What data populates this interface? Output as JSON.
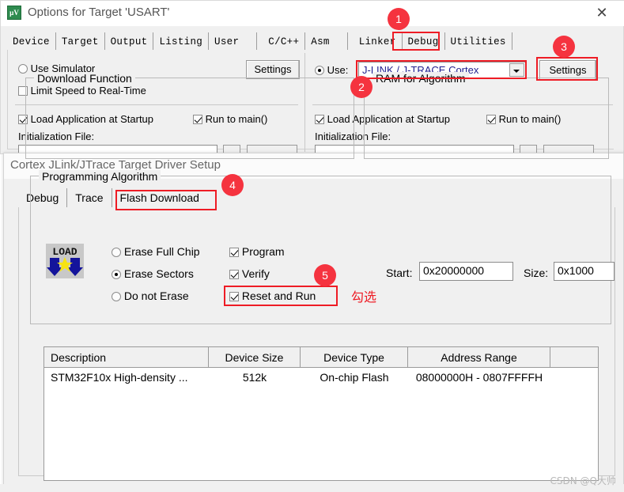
{
  "options_dialog": {
    "title": "Options for Target 'USART'",
    "app_icon": "uvision-icon",
    "close_icon": "close-icon",
    "tabs": [
      {
        "label": "Device",
        "selected": false
      },
      {
        "label": "Target",
        "selected": false
      },
      {
        "label": "Output",
        "selected": false
      },
      {
        "label": "Listing",
        "selected": false
      },
      {
        "label": "User",
        "selected": false
      },
      {
        "label": "C/C++",
        "selected": false
      },
      {
        "label": "Asm",
        "selected": false
      },
      {
        "label": "Linker",
        "selected": false
      },
      {
        "label": "Debug",
        "selected": true
      },
      {
        "label": "Utilities",
        "selected": false
      }
    ],
    "left_panel": {
      "use_simulator_label": "Use Simulator",
      "use_simulator_checked": false,
      "limit_speed_label": "Limit Speed to Real-Time",
      "limit_speed_checked": false,
      "settings_label": "Settings",
      "load_application_label": "Load Application at Startup",
      "load_application_checked": true,
      "run_to_main_label": "Run to main()",
      "run_to_main_checked": true,
      "init_file_label": "Initialization File:",
      "init_file_value": ""
    },
    "right_panel": {
      "use_label": "Use:",
      "use_checked": true,
      "driver_value": "J-LINK / J-TRACE Cortex",
      "settings_label": "Settings",
      "load_application_label": "Load Application at Startup",
      "load_application_checked": true,
      "run_to_main_label": "Run to main()",
      "run_to_main_checked": true,
      "init_file_label": "Initialization File:",
      "init_file_value": ""
    }
  },
  "jlink_dialog": {
    "title": "Cortex JLink/JTrace Target Driver Setup",
    "tabs": [
      {
        "label": "Debug",
        "selected": false
      },
      {
        "label": "Trace",
        "selected": false
      },
      {
        "label": "Flash Download",
        "selected": true
      }
    ],
    "download_function": {
      "group_title": "Download Function",
      "load_icon": "load-icon",
      "load_icon_text": "LOAD",
      "erase_full_chip_label": "Erase Full Chip",
      "erase_full_chip_checked": false,
      "erase_sectors_label": "Erase Sectors",
      "erase_sectors_checked": true,
      "do_not_erase_label": "Do not Erase",
      "do_not_erase_checked": false,
      "program_label": "Program",
      "program_checked": true,
      "verify_label": "Verify",
      "verify_checked": true,
      "reset_and_run_label": "Reset and Run",
      "reset_and_run_checked": true
    },
    "ram_for_algorithm": {
      "group_title": "RAM for Algorithm",
      "start_label": "Start:",
      "start_value": "0x20000000",
      "size_label": "Size:",
      "size_value": "0x1000"
    },
    "programming_algorithm": {
      "group_title": "Programming Algorithm",
      "columns": [
        "Description",
        "Device Size",
        "Device Type",
        "Address Range",
        ""
      ],
      "rows": [
        {
          "description": "STM32F10x High-density ...",
          "device_size": "512k",
          "device_type": "On-chip Flash",
          "address_range": "08000000H - 0807FFFFH",
          "extra": ""
        }
      ]
    }
  },
  "annotations": {
    "badges": [
      {
        "id": "1",
        "target": "debug-tab"
      },
      {
        "id": "2",
        "target": "driver-select"
      },
      {
        "id": "3",
        "target": "jlink-settings-button"
      },
      {
        "id": "4",
        "target": "flash-download-tab"
      },
      {
        "id": "5",
        "target": "reset-and-run-checkbox"
      }
    ],
    "note_text": "勾选",
    "highlight_color": "#ee1c25",
    "badge_color": "#f5333f"
  },
  "watermark": {
    "text": "CSDN @Q大帅"
  }
}
